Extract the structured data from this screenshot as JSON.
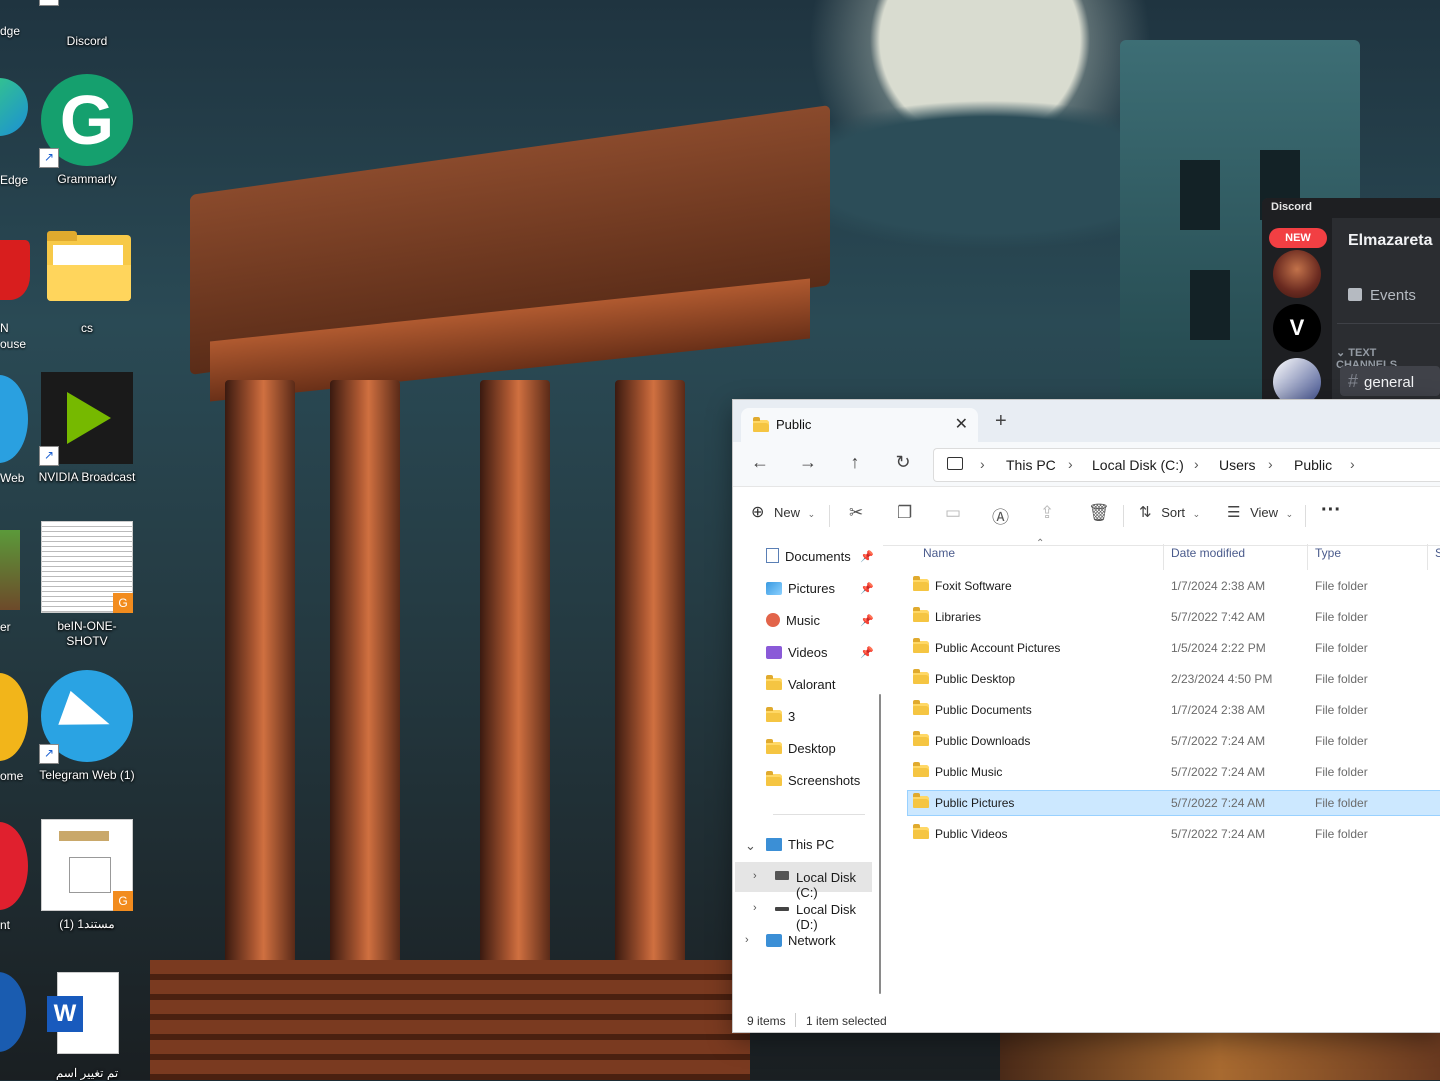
{
  "desktop": {
    "icons": [
      {
        "label": "Discord"
      },
      {
        "label": "Grammarly"
      },
      {
        "label": "cs"
      },
      {
        "label": "NVIDIA Broadcast"
      },
      {
        "label": "beIN-ONE-SHOTV"
      },
      {
        "label": "Telegram Web (1)"
      },
      {
        "label": "مستند1 (1)"
      },
      {
        "label": "تم تغيير اسم"
      }
    ],
    "partial_labels": [
      "dge",
      "Edge",
      "N",
      "ouse",
      "Web",
      "er",
      "ome",
      "nt"
    ]
  },
  "discord": {
    "app_title": "Discord",
    "badge": "NEW",
    "server_name": "Elmazareta",
    "events_label": "Events",
    "category_label": "TEXT CHANNELS",
    "channel_label": "general"
  },
  "explorer": {
    "tab_title": "Public",
    "breadcrumbs": [
      "This PC",
      "Local Disk (C:)",
      "Users",
      "Public"
    ],
    "toolbar": {
      "new_label": "New",
      "sort_label": "Sort",
      "view_label": "View",
      "more_label": "···"
    },
    "nav": {
      "quick": [
        {
          "label": "Documents",
          "pinned": true
        },
        {
          "label": "Pictures",
          "pinned": true
        },
        {
          "label": "Music",
          "pinned": true
        },
        {
          "label": "Videos",
          "pinned": true
        },
        {
          "label": "Valorant",
          "pinned": false
        },
        {
          "label": "3",
          "pinned": false
        },
        {
          "label": "Desktop",
          "pinned": false
        },
        {
          "label": "Screenshots",
          "pinned": false
        }
      ],
      "this_pc": "This PC",
      "drives": [
        "Local Disk (C:)",
        "Local Disk (D:)"
      ],
      "network": "Network"
    },
    "columns": {
      "name": "Name",
      "date": "Date modified",
      "type": "Type",
      "size": "S"
    },
    "files": [
      {
        "name": "Foxit Software",
        "date": "1/7/2024 2:38 AM",
        "type": "File folder"
      },
      {
        "name": "Libraries",
        "date": "5/7/2022 7:42 AM",
        "type": "File folder"
      },
      {
        "name": "Public Account Pictures",
        "date": "1/5/2024 2:22 PM",
        "type": "File folder"
      },
      {
        "name": "Public Desktop",
        "date": "2/23/2024 4:50 PM",
        "type": "File folder"
      },
      {
        "name": "Public Documents",
        "date": "1/7/2024 2:38 AM",
        "type": "File folder"
      },
      {
        "name": "Public Downloads",
        "date": "5/7/2022 7:24 AM",
        "type": "File folder"
      },
      {
        "name": "Public Music",
        "date": "5/7/2022 7:24 AM",
        "type": "File folder"
      },
      {
        "name": "Public Pictures",
        "date": "5/7/2022 7:24 AM",
        "type": "File folder",
        "selected": true
      },
      {
        "name": "Public Videos",
        "date": "5/7/2022 7:24 AM",
        "type": "File folder"
      }
    ],
    "status": {
      "count": "9 items",
      "selection": "1 item selected"
    }
  },
  "colors": {
    "accent": "#0067c0",
    "selection": "#cce8ff",
    "folder": "#f5c542",
    "discord_new": "#f23f43"
  }
}
